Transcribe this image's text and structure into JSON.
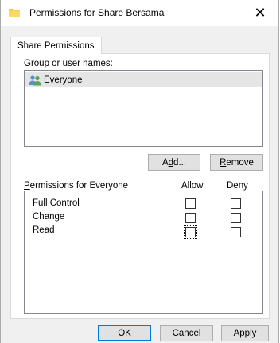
{
  "window": {
    "title": "Permissions for Share Bersama",
    "close_glyph": "✕"
  },
  "tabs": [
    {
      "label": "Share Permissions"
    }
  ],
  "group_section": {
    "label": "Group or user names:",
    "users": [
      {
        "name": "Everyone",
        "icon": "users-icon",
        "selected": true
      }
    ]
  },
  "buttons": {
    "add": "Add...",
    "remove": "Remove",
    "ok": "OK",
    "cancel": "Cancel",
    "apply": "Apply"
  },
  "permissions": {
    "label": "Permissions for Everyone",
    "col_allow": "Allow",
    "col_deny": "Deny",
    "rows": [
      {
        "name": "Full Control",
        "allow": false,
        "deny": false
      },
      {
        "name": "Change",
        "allow": false,
        "deny": false
      },
      {
        "name": "Read",
        "allow": false,
        "deny": false,
        "focused": true
      }
    ]
  },
  "colors": {
    "folder": "#f5c542",
    "default_button_border": "#0078d7",
    "selection": "#e5e5e5"
  }
}
